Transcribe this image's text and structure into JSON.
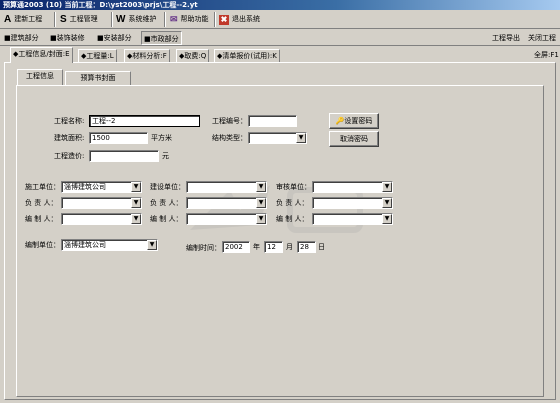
{
  "window": {
    "title": "预算通2003 (10)   当前工程：D:\\yst2003\\prjs\\工程--2.yt"
  },
  "toolbar": {
    "items": [
      {
        "icon": "A",
        "label": "建新工程"
      },
      {
        "icon": "S",
        "label": "工程管理"
      },
      {
        "icon": "W",
        "label": "系统维护"
      },
      {
        "icon": "✉",
        "label": "帮助功能"
      },
      {
        "icon": "✖",
        "label": "退出系统"
      }
    ]
  },
  "sections": {
    "items": [
      "建筑部分",
      "装饰装修",
      "安装部分",
      "市政部分"
    ],
    "active_index": 3,
    "export_label": "工程导出",
    "close_label": "关闭工程"
  },
  "tabs": {
    "items": [
      "◆工程信息/封面:E",
      "◆工程量:L",
      "◆材料分析:F",
      "◆取费:Q",
      "◆清单报价(试用):K"
    ],
    "active_index": 0,
    "fullscreen_label": "全屏:F1"
  },
  "subtabs": {
    "items": [
      "工程信息",
      "预算书封面"
    ],
    "active_index": 0
  },
  "form": {
    "project_name_label": "工程名称:",
    "project_name_value": "工程--2",
    "project_no_label": "工程编号：",
    "project_no_value": "",
    "building_area_label": "建筑面积:",
    "building_area_value": "1500",
    "area_unit": "平方米",
    "structure_label": "结构类型：",
    "structure_value": "",
    "cost_label": "工程造价:",
    "cost_value": "",
    "cost_unit": "元",
    "set_password_button": "设置密码",
    "cancel_password_button": "取消密码",
    "construction_unit_label": "施工单位：",
    "construction_unit_value": "淄博建筑公司",
    "builder_unit_label": "建设单位：",
    "builder_unit_value": "",
    "audit_unit_label": "审核单位：",
    "audit_unit_value": "",
    "responsible_label": "负 责 人：",
    "compiler_label": "编 制 人：",
    "compile_unit_label": "编制单位：",
    "compile_unit_value": "淄博建筑公司",
    "compile_time_label": "编制时间：",
    "year_value": "2002",
    "year_unit": "年",
    "month_value": "12",
    "month_unit": "月",
    "day_value": "28",
    "day_unit": "日"
  },
  "colors": {
    "titlebar_start": "#0a246a",
    "titlebar_end": "#a6caf0",
    "face": "#d4d0c8"
  }
}
